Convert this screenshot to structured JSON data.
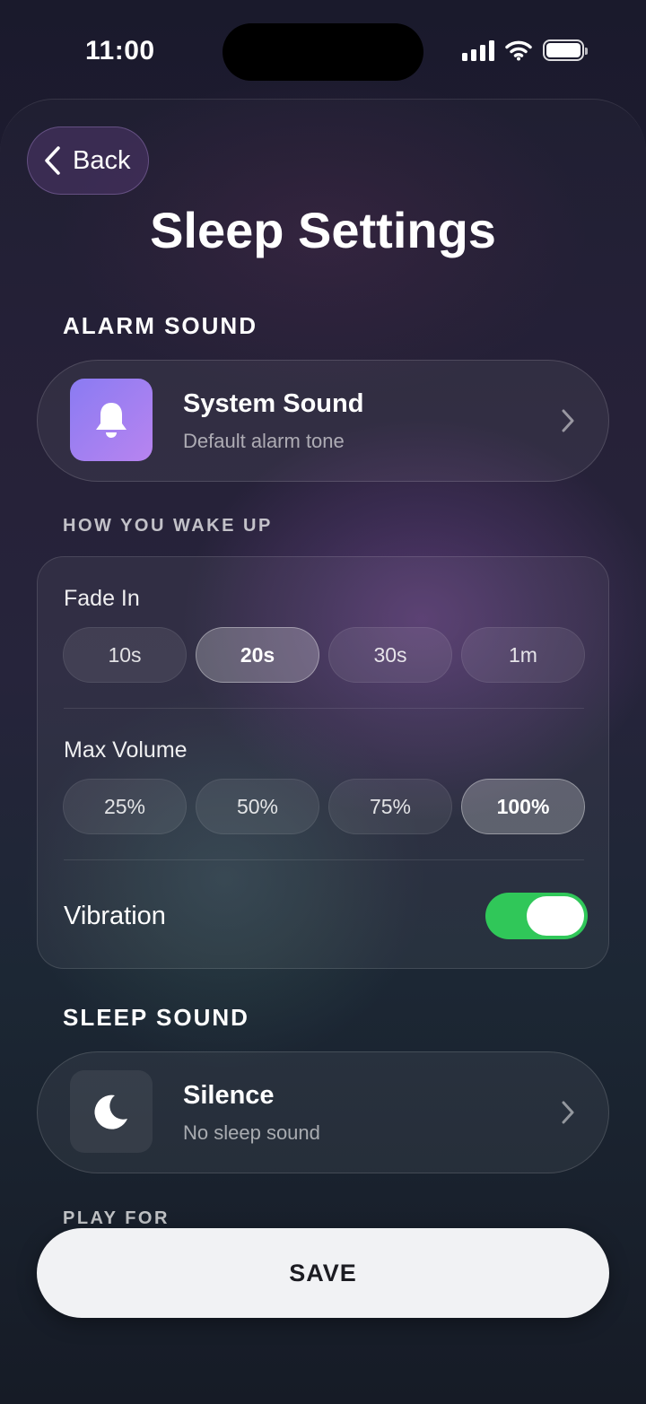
{
  "status_bar": {
    "time": "11:00"
  },
  "header": {
    "back_label": "Back",
    "title": "Sleep Settings"
  },
  "alarm_sound": {
    "section_label": "ALARM SOUND",
    "item": {
      "title": "System Sound",
      "subtitle": "Default alarm tone",
      "icon": "bell-icon"
    }
  },
  "wake_up": {
    "section_label": "HOW YOU WAKE UP",
    "fade_in": {
      "label": "Fade In",
      "options": [
        "10s",
        "20s",
        "30s",
        "1m"
      ],
      "selected": "20s"
    },
    "max_volume": {
      "label": "Max Volume",
      "options": [
        "25%",
        "50%",
        "75%",
        "100%"
      ],
      "selected": "100%"
    },
    "vibration": {
      "label": "Vibration",
      "enabled": true
    }
  },
  "sleep_sound": {
    "section_label": "SLEEP SOUND",
    "item": {
      "title": "Silence",
      "subtitle": "No sleep sound",
      "icon": "moon-icon"
    }
  },
  "play_for": {
    "section_label": "PLAY FOR"
  },
  "footer": {
    "save_label": "SAVE"
  },
  "colors": {
    "toggle_on": "#30c759",
    "tile_gradient_start": "#8a7bf2",
    "tile_gradient_end": "#b884f0"
  }
}
